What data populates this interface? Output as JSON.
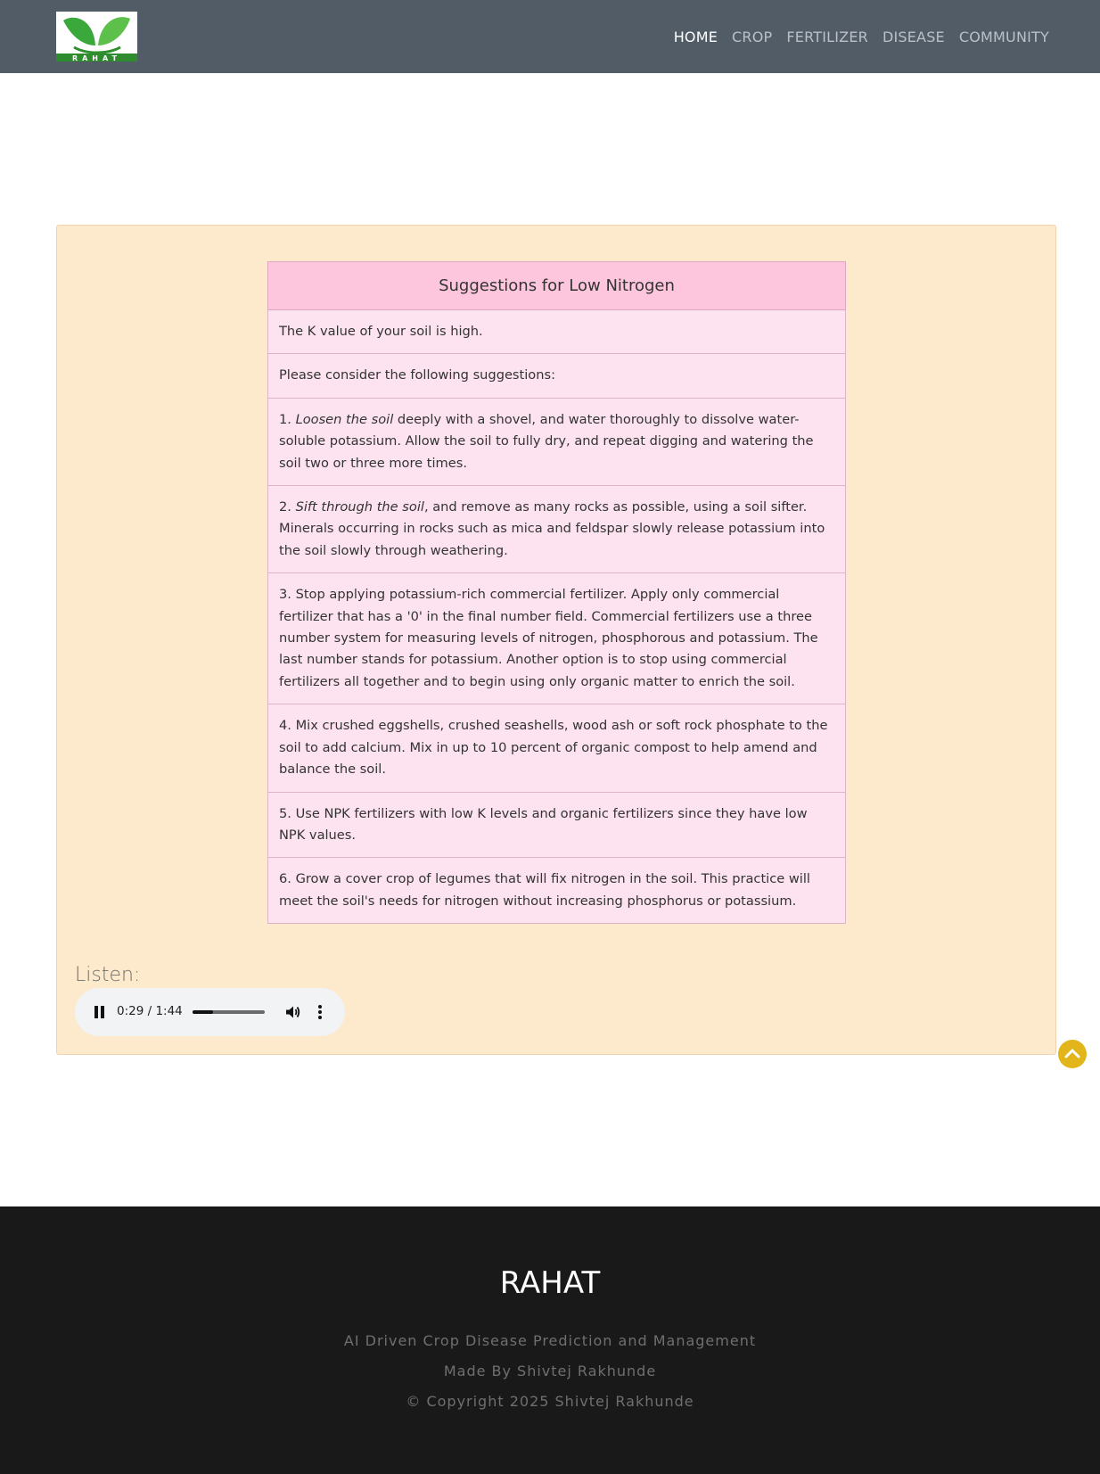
{
  "header": {
    "logo_text": "RAHAT",
    "nav": [
      "HOME",
      "CROP",
      "FERTILIZER",
      "DISEASE",
      "COMMUNITY"
    ]
  },
  "suggestions": {
    "title": "Suggestions for Low Nitrogen",
    "intro": "The K value of your soil is high.",
    "consider": "Please consider the following suggestions:",
    "item1": {
      "num": "1. ",
      "em": "Loosen the soil",
      "rest": " deeply with a shovel, and water thoroughly to dissolve water-soluble potassium. Allow the soil to fully dry, and repeat digging and watering the soil two or three more times."
    },
    "item2": {
      "num": "2. ",
      "em": "Sift through the soil",
      "rest": ", and remove as many rocks as possible, using a soil sifter. Minerals occurring in rocks such as mica and feldspar slowly release potassium into the soil slowly through weathering."
    },
    "item3": "3. Stop applying potassium-rich commercial fertilizer. Apply only commercial fertilizer that has a '0' in the final number field. Commercial fertilizers use a three number system for measuring levels of nitrogen, phosphorous and potassium. The last number stands for potassium. Another option is to stop using commercial fertilizers all together and to begin using only organic matter to enrich the soil.",
    "item4": "4. Mix crushed eggshells, crushed seashells, wood ash or soft rock phosphate to the soil to add calcium. Mix in up to 10 percent of organic compost to help amend and balance the soil.",
    "item5": "5. Use NPK fertilizers with low K levels and organic fertilizers since they have low NPK values.",
    "item6": "6. Grow a cover crop of legumes that will fix nitrogen in the soil. This practice will meet the soil's needs for nitrogen without increasing phosphorus or potassium."
  },
  "audio": {
    "label": "Listen:",
    "time": "0:29 / 1:44",
    "progress": 0.28
  },
  "footer": {
    "brand": "RAHAT",
    "tagline": "AI Driven Crop Disease Prediction and Management",
    "made_by": "Made By Shivtej Rakhunde",
    "copyright": "© Copyright 2025 Shivtej Rakhunde"
  },
  "colors": {
    "navbar": "#525c67",
    "panel": "#fde9cb",
    "table_header": "#fdc6dc",
    "table_cell": "#fde3ef",
    "scroll_top": "#e2b51a",
    "footer": "#191919"
  }
}
